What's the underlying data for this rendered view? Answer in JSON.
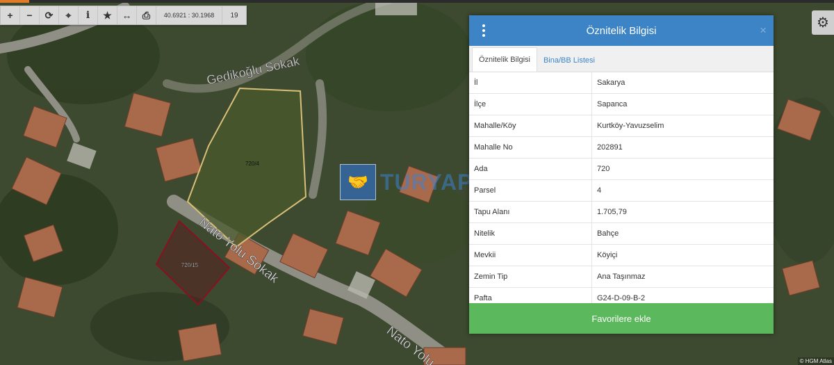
{
  "toolbar": {
    "coords": "40.6921 : 30.1968",
    "zoom": "19",
    "icons": [
      "plus-icon",
      "minus-icon",
      "refresh-icon",
      "locate-icon",
      "info-icon",
      "star-icon",
      "measure-icon",
      "print-icon"
    ]
  },
  "map": {
    "streets": [
      "Gedikoğlu Sokak",
      "Nato Yolu Sokak",
      "Nato Yolu"
    ],
    "parcels": [
      "720/4",
      "720/15"
    ],
    "watermark": "TURYAP",
    "attribution": "© HGM Atlas"
  },
  "panel": {
    "title": "Öznitelik Bilgisi",
    "close": "×",
    "tabs": [
      {
        "label": "Öznitelik Bilgisi",
        "active": true
      },
      {
        "label": "Bina/BB Listesi",
        "active": false
      }
    ],
    "rows": [
      {
        "key": "İl",
        "value": "Sakarya"
      },
      {
        "key": "İlçe",
        "value": "Sapanca"
      },
      {
        "key": "Mahalle/Köy",
        "value": "Kurtköy-Yavuzselim"
      },
      {
        "key": "Mahalle No",
        "value": "202891"
      },
      {
        "key": "Ada",
        "value": "720"
      },
      {
        "key": "Parsel",
        "value": "4"
      },
      {
        "key": "Tapu Alanı",
        "value": "1.705,79"
      },
      {
        "key": "Nitelik",
        "value": "Bahçe"
      },
      {
        "key": "Mevkii",
        "value": "Köyiçi"
      },
      {
        "key": "Zemin Tip",
        "value": "Ana Taşınmaz"
      },
      {
        "key": "Pafta",
        "value": "G24-D-09-B-2"
      }
    ],
    "fav_button": "Favorilere ekle"
  },
  "colors": {
    "header": "#3c84c6",
    "fav": "#5cb85c",
    "parcel_selected": "#d8c07a",
    "parcel_other": "#8a1020"
  }
}
